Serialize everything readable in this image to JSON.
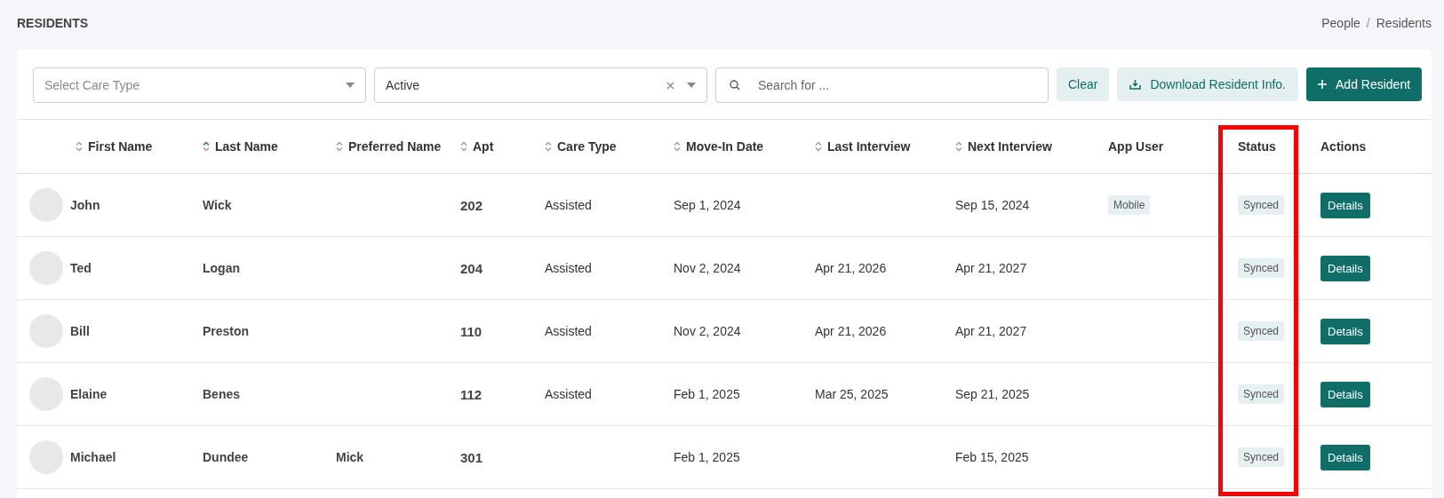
{
  "page_title": "RESIDENTS",
  "breadcrumb": {
    "items": [
      "People",
      "Residents"
    ],
    "separator": "/"
  },
  "filters": {
    "care_type": {
      "placeholder": "Select Care Type"
    },
    "status": {
      "value": "Active"
    },
    "search": {
      "placeholder": "Search for ..."
    }
  },
  "buttons": {
    "clear": "Clear",
    "download": "Download Resident Info.",
    "add": "Add Resident"
  },
  "columns": [
    {
      "label": "First Name",
      "sortable": true,
      "sorted_asc": false,
      "highlighted": false
    },
    {
      "label": "Last Name",
      "sortable": true,
      "sorted_asc": true,
      "highlighted": false
    },
    {
      "label": "Preferred Name",
      "sortable": true,
      "sorted_asc": false,
      "highlighted": false
    },
    {
      "label": "Apt",
      "sortable": true,
      "sorted_asc": false,
      "highlighted": false
    },
    {
      "label": "Care Type",
      "sortable": true,
      "sorted_asc": false,
      "highlighted": false
    },
    {
      "label": "Move-In Date",
      "sortable": true,
      "sorted_asc": false,
      "highlighted": false
    },
    {
      "label": "Last Interview",
      "sortable": true,
      "sorted_asc": false,
      "highlighted": false
    },
    {
      "label": "Next Interview",
      "sortable": true,
      "sorted_asc": false,
      "highlighted": false
    },
    {
      "label": "App User",
      "highlighted": false
    },
    {
      "label": "Status",
      "highlighted": true
    },
    {
      "label": "Actions",
      "highlighted": false
    }
  ],
  "rows": [
    {
      "first_name": "John",
      "last_name": "Wick",
      "apt": "202",
      "care_type": "Assisted",
      "move_in": "Sep 1, 2024",
      "next_interview": "Sep 15, 2024",
      "app_user": "Mobile",
      "status": "Synced",
      "action": "Details"
    },
    {
      "first_name": "Ted",
      "last_name": "Logan",
      "apt": "204",
      "care_type": "Assisted",
      "move_in": "Nov 2, 2024",
      "last_interview": "Apr 21, 2026",
      "next_interview": "Apr 21, 2027",
      "status": "Synced",
      "action": "Details"
    },
    {
      "first_name": "Bill",
      "last_name": "Preston",
      "apt": "110",
      "care_type": "Assisted",
      "move_in": "Nov 2, 2024",
      "last_interview": "Apr 21, 2026",
      "next_interview": "Apr 21, 2027",
      "status": "Synced",
      "action": "Details"
    },
    {
      "first_name": "Elaine",
      "last_name": "Benes",
      "apt": "112",
      "care_type": "Assisted",
      "move_in": "Feb 1, 2025",
      "last_interview": "Mar 25, 2025",
      "next_interview": "Sep 21, 2025",
      "status": "Synced",
      "action": "Details"
    },
    {
      "first_name": "Michael",
      "last_name": "Dundee",
      "preferred_name": "Mick",
      "apt": "301",
      "move_in": "Feb 1, 2025",
      "next_interview": "Feb 15, 2025",
      "status": "Synced",
      "action": "Details"
    }
  ]
}
